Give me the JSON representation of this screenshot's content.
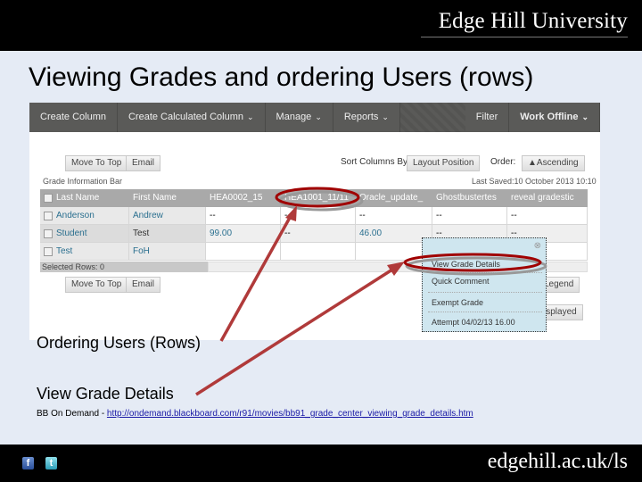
{
  "header": {
    "brand": "Edge Hill University"
  },
  "slide": {
    "title": "Viewing Grades and ordering Users (rows)"
  },
  "screenshot": {
    "toolbar": [
      {
        "label": "Create Column",
        "dropdown": false
      },
      {
        "label": "Create Calculated Column",
        "dropdown": true
      },
      {
        "label": "Manage",
        "dropdown": true
      },
      {
        "label": "Reports",
        "dropdown": true
      },
      {
        "label": "Filter",
        "dropdown": false
      },
      {
        "label": "Work Offline",
        "dropdown": true
      }
    ],
    "chevron": "⌄",
    "move_to_top": "Move To Top",
    "email": "Email",
    "sort_label": "Sort Columns By:",
    "sort_value": "Layout Position",
    "order_label": "Order:",
    "order_value": "▲Ascending",
    "grade_info_bar": "Grade Information Bar",
    "last_saved": "Last Saved:10 October 2013 10:10",
    "columns": [
      "Last Name",
      "First Name",
      "HEA0002_15",
      "HEA1001_11/11",
      "Oracle_update_",
      "Ghostbustertes",
      "reveal gradestic"
    ],
    "rows": [
      {
        "last": "Anderson",
        "first": "Andrew",
        "c1": "--",
        "c2": "--",
        "c3": "--",
        "c4": "--",
        "c5": "--"
      },
      {
        "last": "Student",
        "first": "Test",
        "c1": "99.00",
        "c2": "--",
        "c3": "46.00",
        "c4": "--",
        "c5": "--"
      },
      {
        "last": "Test",
        "first": "FoH",
        "c1": "",
        "c2": "",
        "c3": "",
        "c4": "",
        "c5": ""
      }
    ],
    "selected_rows": "Selected Rows: 0",
    "legend": "Legend",
    "displayed": "isplayed",
    "popup": {
      "items": [
        "View Grade Details",
        "Quick Comment",
        "Exempt Grade",
        "Attempt 04/02/13 16.00"
      ]
    }
  },
  "captions": {
    "ordering": "Ordering Users (Rows)",
    "view_details": "View Grade Details"
  },
  "reference": {
    "prefix": "BB On Demand - ",
    "url": "http://ondemand.blackboard.com/r91/movies/bb91_grade_center_viewing_grade_details.htm"
  },
  "footer": {
    "site": "edgehill.ac.uk/ls",
    "facebook": "f",
    "twitter": "t"
  },
  "colors": {
    "annotation": "#b03a3a",
    "highlight_ring": "#a00000"
  }
}
